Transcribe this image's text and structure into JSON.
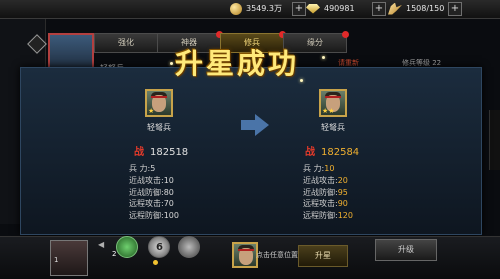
{
  "topbar": {
    "coins": "3549.3万",
    "gold": "490981",
    "stamina": "1508/150",
    "plus": "+"
  },
  "tabs": [
    {
      "label": "强化"
    },
    {
      "label": "神器"
    },
    {
      "label": "修兵"
    },
    {
      "label": "缘分"
    }
  ],
  "behind": {
    "left_text": "请重新",
    "right_text": "修兵等级 22",
    "name_text": "轻弩兵"
  },
  "popup": {
    "title": "升星成功",
    "before": {
      "name": "轻弩兵",
      "power_label": "战",
      "power": "182518",
      "stats": [
        {
          "label": "兵      力:",
          "value": "5"
        },
        {
          "label": "近战攻击:",
          "value": "10"
        },
        {
          "label": "近战防御:",
          "value": "80"
        },
        {
          "label": "远程攻击:",
          "value": "70"
        },
        {
          "label": "远程防御:",
          "value": "100"
        }
      ]
    },
    "after": {
      "name": "轻弩兵",
      "power_label": "战",
      "power": "182584",
      "stats": [
        {
          "label": "兵      力:",
          "value": "10"
        },
        {
          "label": "近战攻击:",
          "value": "20"
        },
        {
          "label": "近战防御:",
          "value": "95"
        },
        {
          "label": "远程攻击:",
          "value": "90"
        },
        {
          "label": "远程防御:",
          "value": "120"
        }
      ]
    }
  },
  "bottom": {
    "portrait_num": "1",
    "page_arrow": "◀",
    "skill_nums": [
      "2",
      "6"
    ],
    "tip": "点击任意位置继续",
    "upstar_label": "升星",
    "upgrade_label": "升级"
  },
  "icons": {
    "coin": "coin-icon",
    "gold": "gold-icon",
    "stamina": "wing-icon",
    "arrow": "arrow-right-icon"
  }
}
